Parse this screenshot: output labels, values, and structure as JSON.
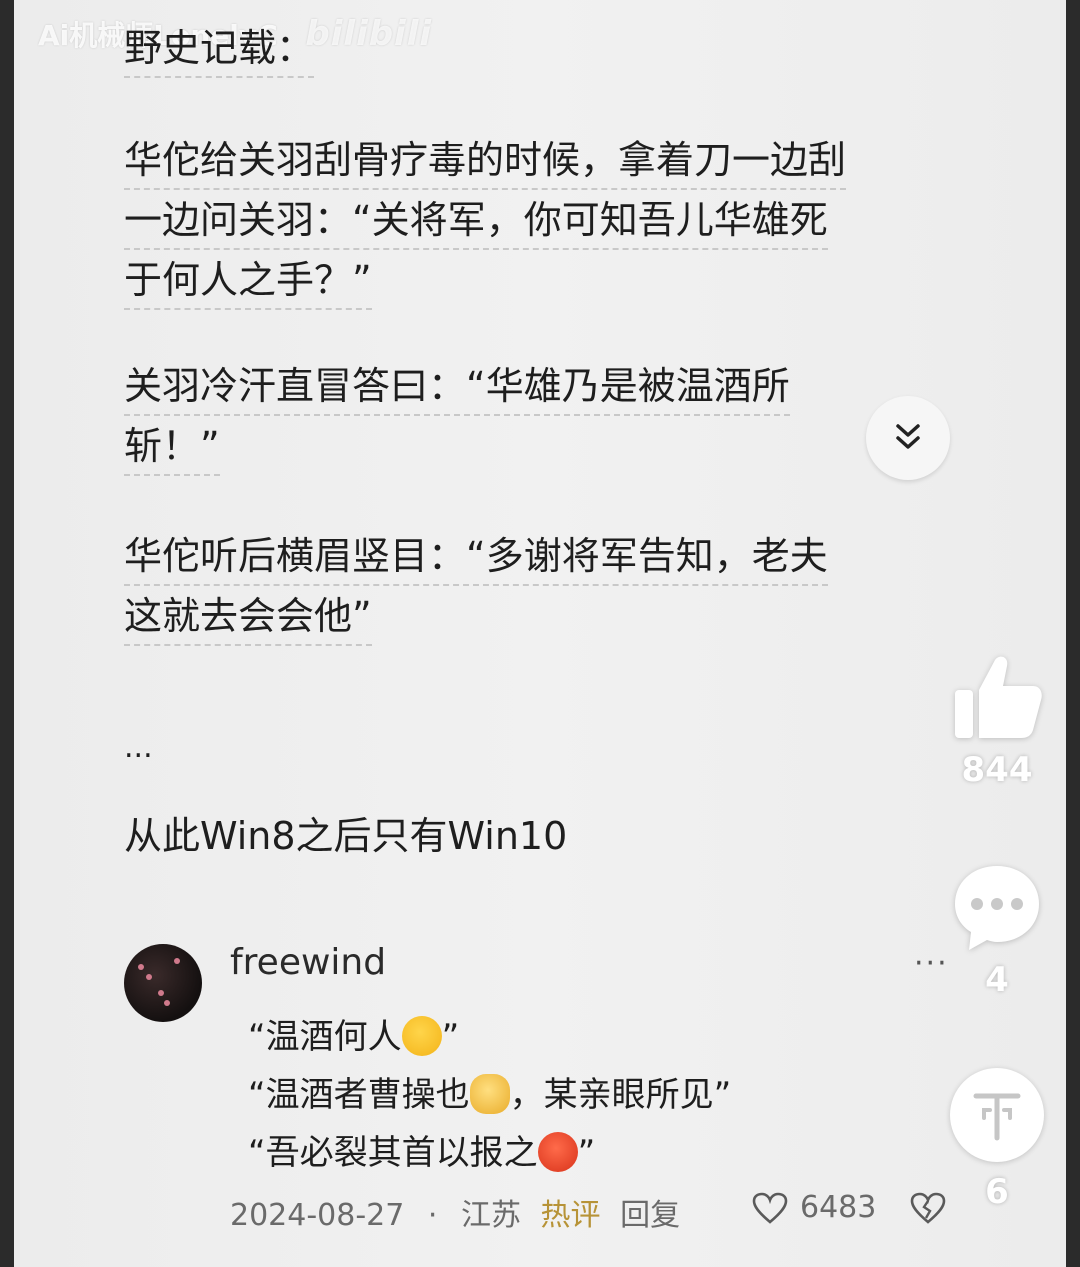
{
  "watermark": {
    "author": "Ai机械师LonelyC",
    "site": "bilibili"
  },
  "post": {
    "paragraphs": [
      [
        "野史记载："
      ],
      [
        "华佗给关羽刮骨疗毒的时候，拿着刀一边刮",
        "一边问关羽：“关将军，你可知吾儿华雄死",
        "于何人之手？”"
      ],
      [
        "关羽冷汗直冒答曰：“华雄乃是被温酒所",
        "斩！”"
      ],
      [
        "华佗听后横眉竖目：“多谢将军告知，老夫",
        "这就去会会他”"
      ],
      [
        "..."
      ],
      [
        "从此Win8之后只有Win10"
      ]
    ]
  },
  "comment": {
    "username": "freewind",
    "more": "···",
    "lines": [
      {
        "text": "“温酒何人",
        "emoji": "thinking-face",
        "tail": "”"
      },
      {
        "text": "“温酒者曹操也",
        "emoji": "cat-face",
        "tail": "，某亲眼所见”"
      },
      {
        "text": "“吾必裂其首以报之",
        "emoji": "angry-face",
        "tail": "”"
      }
    ],
    "date": "2024-08-27",
    "separator": "·",
    "location": "江苏",
    "hot_tag": "热评",
    "reply_label": "回复",
    "like_count": "6483"
  },
  "sidebar": {
    "likes": "844",
    "comments": "4",
    "shares": "6"
  },
  "colors": {
    "hot_tag": "#b79337",
    "text": "#1e1e1e",
    "meta": "#6a6a6a"
  }
}
